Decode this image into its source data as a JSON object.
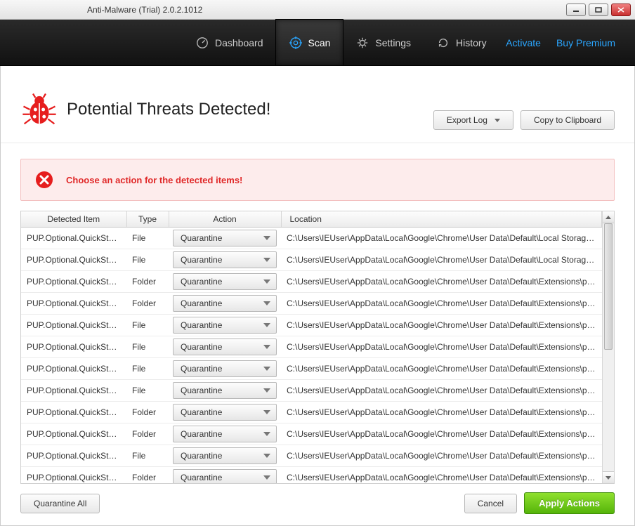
{
  "window": {
    "title": "Anti-Malware (Trial) 2.0.2.1012"
  },
  "nav": {
    "items": [
      {
        "id": "dashboard",
        "label": "Dashboard",
        "icon": "gauge"
      },
      {
        "id": "scan",
        "label": "Scan",
        "icon": "target",
        "active": true
      },
      {
        "id": "settings",
        "label": "Settings",
        "icon": "gear"
      },
      {
        "id": "history",
        "label": "History",
        "icon": "refresh"
      }
    ],
    "rightLinks": {
      "activate": "Activate",
      "buy": "Buy Premium"
    }
  },
  "header": {
    "title": "Potential Threats Detected!",
    "exportLog": "Export Log",
    "copyClipboard": "Copy to Clipboard"
  },
  "alert": {
    "text": "Choose an action for the detected items!"
  },
  "table": {
    "columns": {
      "detected": "Detected Item",
      "type": "Type",
      "action": "Action",
      "location": "Location"
    },
    "rows": [
      {
        "detected": "PUP.Optional.QuickStart.A",
        "type": "File",
        "action": "Quarantine",
        "location": "C:\\Users\\IEUser\\AppData\\Local\\Google\\Chrome\\User Data\\Default\\Local Storage\\chrome-e..."
      },
      {
        "detected": "PUP.Optional.QuickStart.A",
        "type": "File",
        "action": "Quarantine",
        "location": "C:\\Users\\IEUser\\AppData\\Local\\Google\\Chrome\\User Data\\Default\\Local Storage\\chrome-e..."
      },
      {
        "detected": "PUP.Optional.QuickStart.A",
        "type": "Folder",
        "action": "Quarantine",
        "location": "C:\\Users\\IEUser\\AppData\\Local\\Google\\Chrome\\User Data\\Default\\Extensions\\pelmeidfhdlhl..."
      },
      {
        "detected": "PUP.Optional.QuickStart.A",
        "type": "Folder",
        "action": "Quarantine",
        "location": "C:\\Users\\IEUser\\AppData\\Local\\Google\\Chrome\\User Data\\Default\\Extensions\\pelmeidfhdlhl..."
      },
      {
        "detected": "PUP.Optional.QuickStart.A",
        "type": "File",
        "action": "Quarantine",
        "location": "C:\\Users\\IEUser\\AppData\\Local\\Google\\Chrome\\User Data\\Default\\Extensions\\pelmeidfhdlhl..."
      },
      {
        "detected": "PUP.Optional.QuickStart.A",
        "type": "File",
        "action": "Quarantine",
        "location": "C:\\Users\\IEUser\\AppData\\Local\\Google\\Chrome\\User Data\\Default\\Extensions\\pelmeidfhdlhl..."
      },
      {
        "detected": "PUP.Optional.QuickStart.A",
        "type": "File",
        "action": "Quarantine",
        "location": "C:\\Users\\IEUser\\AppData\\Local\\Google\\Chrome\\User Data\\Default\\Extensions\\pelmeidfhdlhl..."
      },
      {
        "detected": "PUP.Optional.QuickStart.A",
        "type": "File",
        "action": "Quarantine",
        "location": "C:\\Users\\IEUser\\AppData\\Local\\Google\\Chrome\\User Data\\Default\\Extensions\\pelmeidfhdlhl..."
      },
      {
        "detected": "PUP.Optional.QuickStart.A",
        "type": "Folder",
        "action": "Quarantine",
        "location": "C:\\Users\\IEUser\\AppData\\Local\\Google\\Chrome\\User Data\\Default\\Extensions\\pelmeidfhdlhl..."
      },
      {
        "detected": "PUP.Optional.QuickStart.A",
        "type": "Folder",
        "action": "Quarantine",
        "location": "C:\\Users\\IEUser\\AppData\\Local\\Google\\Chrome\\User Data\\Default\\Extensions\\pelmeidfhdlhl..."
      },
      {
        "detected": "PUP.Optional.QuickStart.A",
        "type": "File",
        "action": "Quarantine",
        "location": "C:\\Users\\IEUser\\AppData\\Local\\Google\\Chrome\\User Data\\Default\\Extensions\\pelmeidfhdlhl..."
      },
      {
        "detected": "PUP.Optional.QuickStart.A",
        "type": "Folder",
        "action": "Quarantine",
        "location": "C:\\Users\\IEUser\\AppData\\Local\\Google\\Chrome\\User Data\\Default\\Extensions\\pelmeidfhdlhl..."
      }
    ]
  },
  "footer": {
    "quarantineAll": "Quarantine All",
    "cancel": "Cancel",
    "apply": "Apply Actions"
  }
}
